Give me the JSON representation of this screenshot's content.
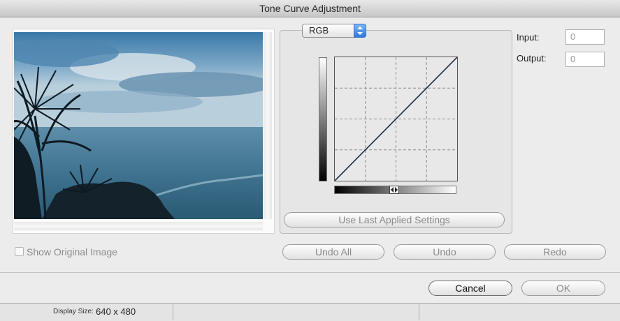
{
  "window": {
    "title": "Tone Curve Adjustment"
  },
  "channel": {
    "selected": "RGB"
  },
  "fields": {
    "input_label": "Input:",
    "input_value": "0",
    "output_label": "Output:",
    "output_value": "0"
  },
  "buttons": {
    "use_last": "Use Last Applied Settings",
    "undo_all": "Undo All",
    "undo": "Undo",
    "redo": "Redo",
    "cancel": "Cancel",
    "ok": "OK"
  },
  "options": {
    "show_original_label": "Show Original Image",
    "show_original_checked": false
  },
  "status": {
    "display_size_label": "Display Size:",
    "display_size_value": "640 x 480"
  },
  "curve": {
    "points": [
      [
        0,
        0
      ],
      [
        255,
        255
      ]
    ],
    "grid_divisions": 4
  },
  "icons": {
    "channel_arrows": "up-down-arrows-icon",
    "slider_handle": "left-right-arrows-icon"
  },
  "colors": {
    "accent": "#3b7fe0"
  }
}
